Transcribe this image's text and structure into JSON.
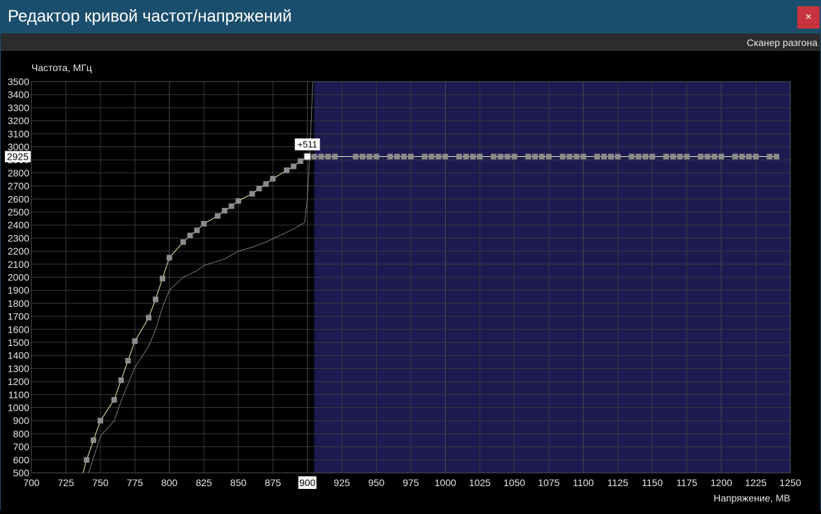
{
  "window": {
    "title": "Редактор кривой частот/напряжений",
    "close_label": "×"
  },
  "toolbar": {
    "scanner_label": "Сканер разгона"
  },
  "colors": {
    "title_bar": "#1b4e6c",
    "close_button": "#c8343d",
    "locked_region": "#1d1a52",
    "curve": "#f2f2b0",
    "point": "#8c8c8c",
    "selected_point": "#ffffff",
    "default_curve": "#7a7a7a",
    "grid": "#3a3a3a"
  },
  "chart_data": {
    "type": "line",
    "ylabel": "Частота, МГц",
    "xlabel": "Напряжение, МВ",
    "xlim": [
      700,
      1250
    ],
    "ylim": [
      500,
      3500
    ],
    "x_ticks": [
      700,
      725,
      750,
      775,
      800,
      825,
      850,
      875,
      900,
      925,
      950,
      975,
      1000,
      1025,
      1050,
      1075,
      1100,
      1125,
      1150,
      1175,
      1200,
      1225,
      1250
    ],
    "y_ticks": [
      500,
      600,
      700,
      800,
      900,
      1000,
      1100,
      1200,
      1300,
      1400,
      1500,
      1600,
      1700,
      1800,
      1900,
      2000,
      2100,
      2200,
      2300,
      2400,
      2500,
      2600,
      2700,
      2800,
      2900,
      3000,
      3100,
      3200,
      3300,
      3400,
      3500
    ],
    "grid": true,
    "locked_region_x": [
      905,
      1250
    ],
    "selected_point": {
      "x": 900,
      "y": 2925,
      "x_label": "900",
      "y_label": "2925",
      "offset_label": "+511"
    },
    "series": [
      {
        "role": "curve",
        "points": [
          [
            735,
            400
          ],
          [
            740,
            600
          ],
          [
            745,
            750
          ],
          [
            750,
            900
          ],
          [
            760,
            1060
          ],
          [
            765,
            1210
          ],
          [
            770,
            1360
          ],
          [
            775,
            1510
          ],
          [
            785,
            1690
          ],
          [
            790,
            1830
          ],
          [
            795,
            1990
          ],
          [
            800,
            2150
          ],
          [
            810,
            2270
          ],
          [
            815,
            2320
          ],
          [
            820,
            2360
          ],
          [
            825,
            2410
          ],
          [
            835,
            2470
          ],
          [
            840,
            2510
          ],
          [
            845,
            2545
          ],
          [
            850,
            2585
          ],
          [
            860,
            2640
          ],
          [
            865,
            2680
          ],
          [
            870,
            2715
          ],
          [
            875,
            2755
          ],
          [
            885,
            2820
          ],
          [
            890,
            2850
          ],
          [
            895,
            2890
          ],
          [
            900,
            2925
          ],
          [
            905,
            2925
          ],
          [
            910,
            2925
          ],
          [
            915,
            2925
          ],
          [
            920,
            2925
          ],
          [
            935,
            2925
          ],
          [
            940,
            2925
          ],
          [
            945,
            2925
          ],
          [
            950,
            2925
          ],
          [
            960,
            2925
          ],
          [
            965,
            2925
          ],
          [
            970,
            2925
          ],
          [
            975,
            2925
          ],
          [
            985,
            2925
          ],
          [
            990,
            2925
          ],
          [
            995,
            2925
          ],
          [
            1000,
            2925
          ],
          [
            1010,
            2925
          ],
          [
            1015,
            2925
          ],
          [
            1020,
            2925
          ],
          [
            1025,
            2925
          ],
          [
            1035,
            2925
          ],
          [
            1040,
            2925
          ],
          [
            1045,
            2925
          ],
          [
            1050,
            2925
          ],
          [
            1060,
            2925
          ],
          [
            1065,
            2925
          ],
          [
            1070,
            2925
          ],
          [
            1075,
            2925
          ],
          [
            1085,
            2925
          ],
          [
            1090,
            2925
          ],
          [
            1095,
            2925
          ],
          [
            1100,
            2925
          ],
          [
            1110,
            2925
          ],
          [
            1115,
            2925
          ],
          [
            1120,
            2925
          ],
          [
            1125,
            2925
          ],
          [
            1135,
            2925
          ],
          [
            1140,
            2925
          ],
          [
            1145,
            2925
          ],
          [
            1150,
            2925
          ],
          [
            1160,
            2925
          ],
          [
            1165,
            2925
          ],
          [
            1170,
            2925
          ],
          [
            1175,
            2925
          ],
          [
            1185,
            2925
          ],
          [
            1190,
            2925
          ],
          [
            1195,
            2925
          ],
          [
            1200,
            2925
          ],
          [
            1210,
            2925
          ],
          [
            1215,
            2925
          ],
          [
            1220,
            2925
          ],
          [
            1225,
            2925
          ],
          [
            1235,
            2925
          ],
          [
            1240,
            2925
          ]
        ]
      },
      {
        "role": "default_curve",
        "points": [
          [
            740,
            450
          ],
          [
            750,
            780
          ],
          [
            760,
            900
          ],
          [
            765,
            1050
          ],
          [
            775,
            1310
          ],
          [
            785,
            1470
          ],
          [
            790,
            1600
          ],
          [
            795,
            1770
          ],
          [
            800,
            1900
          ],
          [
            810,
            2000
          ],
          [
            820,
            2050
          ],
          [
            825,
            2090
          ],
          [
            840,
            2140
          ],
          [
            850,
            2200
          ],
          [
            860,
            2230
          ],
          [
            870,
            2270
          ],
          [
            880,
            2320
          ],
          [
            890,
            2370
          ],
          [
            898,
            2420
          ],
          [
            900,
            2600
          ],
          [
            902,
            3000
          ],
          [
            904,
            3500
          ]
        ]
      }
    ]
  }
}
